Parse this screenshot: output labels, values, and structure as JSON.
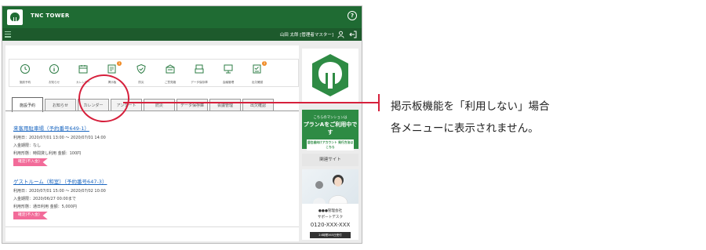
{
  "header": {
    "app_title": "TNC TOWER",
    "help_label": "?",
    "user_name": "山田 太郎 [管理者マスター]"
  },
  "icon_bar": [
    {
      "label": "施設予約",
      "icon": "clock-icon",
      "badge": ""
    },
    {
      "label": "お知らせ",
      "icon": "info-icon",
      "badge": ""
    },
    {
      "label": "カレンダー",
      "icon": "calendar-icon",
      "badge": ""
    },
    {
      "label": "掲示板",
      "icon": "board-icon",
      "badge": "1"
    },
    {
      "label": "防災",
      "icon": "shield-icon",
      "badge": ""
    },
    {
      "label": "ご意見箱",
      "icon": "mailbox-icon",
      "badge": ""
    },
    {
      "label": "データ保存庫",
      "icon": "storage-icon",
      "badge": ""
    },
    {
      "label": "会議管理",
      "icon": "meeting-icon",
      "badge": ""
    },
    {
      "label": "出欠確認",
      "icon": "attendance-icon",
      "badge": "1"
    }
  ],
  "tabs": [
    {
      "label": "施設予約",
      "active": true
    },
    {
      "label": "お知らせ",
      "active": false
    },
    {
      "label": "カレンダー",
      "active": false
    },
    {
      "label": "アンケート",
      "active": false
    },
    {
      "label": "防災",
      "active": false
    },
    {
      "label": "データ保存庫",
      "active": false
    },
    {
      "label": "会議管理",
      "active": false
    },
    {
      "label": "出欠確認",
      "active": false
    }
  ],
  "reservations": [
    {
      "title": "来客用駐車場（予約番号649-1）",
      "date": "利用日：2020/07/01 13:00 〜 2020/07/01 14:00",
      "deadline": "入金期限：なし",
      "usage": "利用形態：時間貸し利用 金額：100円",
      "status": "確定(不入金)"
    },
    {
      "title": "ゲストルーム（和室）（予約番号647-3）",
      "date": "利用日：2020/07/01 15:00 〜 2020/07/02 10:00",
      "deadline": "入金期限：2020/06/27 00:00まで",
      "usage": "利用形態：通日利用 金額：5,000円",
      "status": "確定(不入金)"
    }
  ],
  "sidebar": {
    "promo_line1": "こちらのマンションは",
    "promo_line2": "プランAをご利用中です",
    "promo_button": "居住者向けアカウント 発行方法はこちら",
    "related_label": "関連サイト",
    "support_company": "●●●管理会社",
    "support_desk": "サポートデスク",
    "support_phone": "0120-XXX-XXX",
    "support_hours": "24時間365日受付"
  },
  "annotation": {
    "line1": "掲示板機能を「利用しない」場合",
    "line2": "各メニューに表示されません。"
  },
  "colors": {
    "header_green": "#1f6b33",
    "promo_green": "#2e8b44",
    "link_blue": "#1a66c0",
    "status_pink": "#f26b99",
    "badge_orange": "#f08a24",
    "annotation_red": "#d6203c"
  }
}
